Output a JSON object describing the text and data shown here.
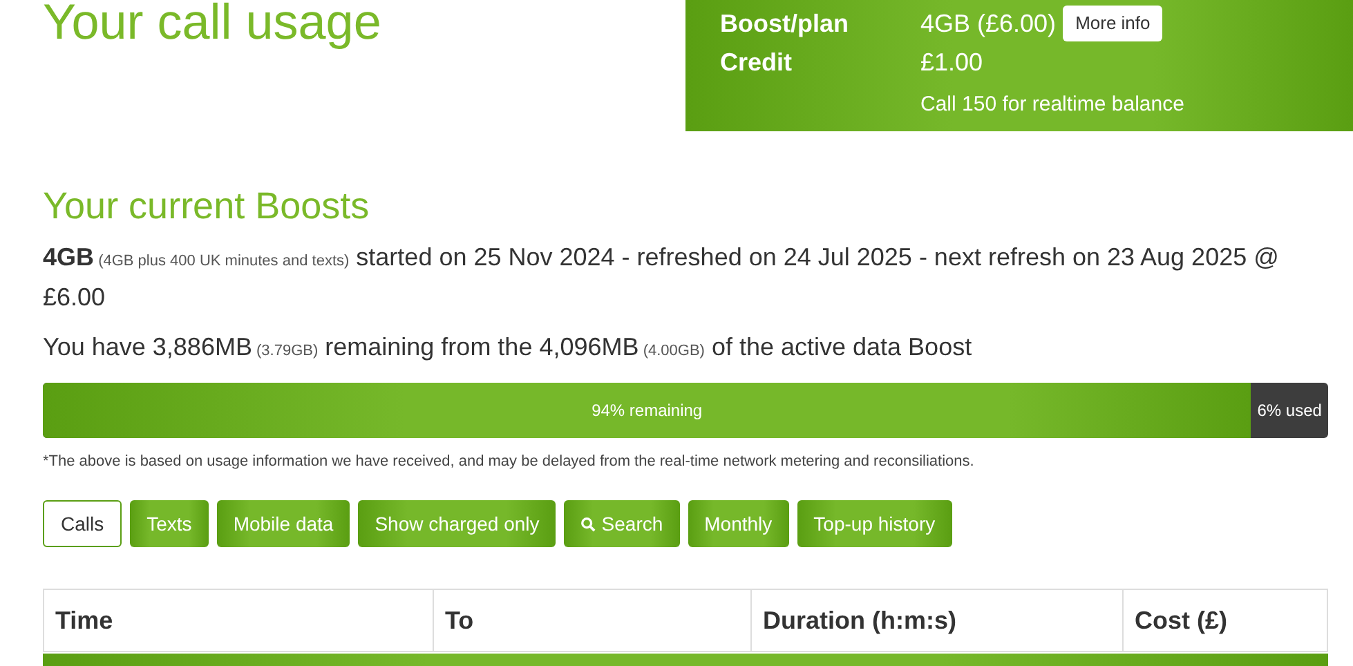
{
  "page_title": "Your call usage",
  "summary_panel": {
    "rows": [
      {
        "label": "Boost/plan",
        "value": "4GB (£6.00)",
        "button": "More info"
      },
      {
        "label": "Credit",
        "value": "£1.00"
      },
      {
        "value": "Call 150 for realtime balance"
      }
    ]
  },
  "boosts": {
    "heading": "Your current Boosts",
    "boost_line": [
      {
        "kind": "main",
        "text": "**4GB**"
      },
      {
        "kind": "aside",
        "text": "(4GB plus 400 UK minutes and texts)"
      },
      {
        "kind": "main",
        "text": "started on 25 Nov 2024 - refreshed on 24 Jul 2025 - next refresh on 23 Aug 2025 @ £6.00"
      }
    ],
    "remaining_line": [
      {
        "kind": "main",
        "text": "You have 3,886MB"
      },
      {
        "kind": "aside",
        "text": "(3.79GB)"
      },
      {
        "kind": "main",
        "text": "remaining from the 4,096MB"
      },
      {
        "kind": "aside",
        "text": "(4.00GB)"
      },
      {
        "kind": "main",
        "text": "of the active data Boost"
      }
    ],
    "usage_bar": {
      "level": 0.94,
      "remaining_label": "94% remaining",
      "used_label": "6% used"
    },
    "note": "*The above is based on usage information we have received, and may be delayed from the real-time network metering and reconsiliations."
  },
  "filters": [
    {
      "label": "Calls",
      "selected": true
    },
    {
      "label": "Texts",
      "selected": false
    },
    {
      "label": "Mobile data",
      "selected": false
    },
    {
      "label": "Show charged only",
      "selected": false
    },
    {
      "label": "Search",
      "selected": false,
      "kind": "search"
    },
    {
      "label": "Monthly",
      "selected": false
    },
    {
      "label": "Top-up history",
      "selected": false
    }
  ],
  "table": {
    "columns": [
      "Time",
      "To",
      "Duration (h:m:s)",
      "Cost (£)"
    ]
  }
}
